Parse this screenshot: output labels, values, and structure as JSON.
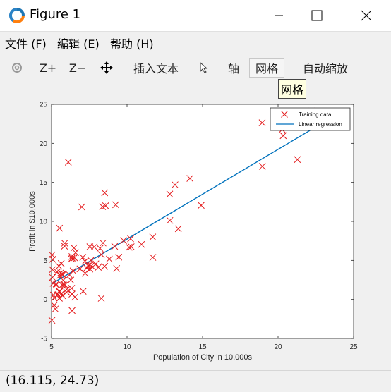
{
  "window": {
    "title": "Figure 1",
    "controls": {
      "minimize_icon": "minimize-icon",
      "maximize_icon": "maximize-icon",
      "close_icon": "close-icon"
    }
  },
  "menu": [
    {
      "label": "文件 (F)"
    },
    {
      "label": "编辑 (E)"
    },
    {
      "label": "帮助 (H)"
    }
  ],
  "toolbar": {
    "rotate_icon": "rotate-icon",
    "zoom_in": "Z+",
    "zoom_out": "Z−",
    "pan_icon": "pan-icon",
    "insert_text": "插入文本",
    "pointer_icon": "pointer-icon",
    "axes": "轴",
    "grid": "网格",
    "autoscale": "自动缩放"
  },
  "tooltip": {
    "text": "网格"
  },
  "status": {
    "coordinates": "(16.115, 24.73)"
  },
  "colors": {
    "marker": "#e41a1c",
    "line": "#0072bd"
  },
  "chart_data": {
    "type": "scatter",
    "xlabel": "Population of City in 10,000s",
    "ylabel": "Profit in $10,000s",
    "xlim": [
      5,
      25
    ],
    "ylim": [
      -5,
      25
    ],
    "xticks": [
      "5",
      "10",
      "15",
      "20",
      "25"
    ],
    "yticks": [
      "-5",
      "0",
      "5",
      "10",
      "15",
      "20",
      "25"
    ],
    "legend_position": "top-right",
    "series": [
      {
        "name": "Training data",
        "marker": "x",
        "points": [
          [
            6.1101,
            17.592
          ],
          [
            5.5277,
            9.1302
          ],
          [
            8.5186,
            13.662
          ],
          [
            7.0032,
            11.854
          ],
          [
            5.8598,
            6.8233
          ],
          [
            8.3829,
            11.886
          ],
          [
            7.4764,
            4.3483
          ],
          [
            8.5781,
            12.0
          ],
          [
            6.4862,
            6.5987
          ],
          [
            5.0546,
            3.8166
          ],
          [
            5.7107,
            3.2522
          ],
          [
            14.164,
            15.505
          ],
          [
            5.734,
            3.1551
          ],
          [
            8.4084,
            7.2258
          ],
          [
            5.6407,
            0.71618
          ],
          [
            5.3794,
            3.5129
          ],
          [
            6.3654,
            5.3048
          ],
          [
            5.1301,
            0.56077
          ],
          [
            6.4296,
            3.6518
          ],
          [
            7.0708,
            5.3893
          ],
          [
            6.1891,
            3.1386
          ],
          [
            20.27,
            21.767
          ],
          [
            5.4901,
            4.263
          ],
          [
            6.3261,
            5.1875
          ],
          [
            5.5649,
            3.0825
          ],
          [
            18.945,
            22.638
          ],
          [
            12.828,
            13.501
          ],
          [
            10.957,
            7.0467
          ],
          [
            13.176,
            14.692
          ],
          [
            22.203,
            24.147
          ],
          [
            5.2524,
            -1.22
          ],
          [
            6.5894,
            5.9966
          ],
          [
            9.2482,
            12.134
          ],
          [
            5.8918,
            1.8495
          ],
          [
            8.2111,
            6.5426
          ],
          [
            7.9334,
            4.5623
          ],
          [
            8.0959,
            4.1164
          ],
          [
            5.6063,
            3.3928
          ],
          [
            12.836,
            10.117
          ],
          [
            6.3534,
            5.4974
          ],
          [
            5.4069,
            0.55657
          ],
          [
            6.8825,
            3.9115
          ],
          [
            11.708,
            5.3854
          ],
          [
            5.7737,
            2.4406
          ],
          [
            7.8247,
            6.7318
          ],
          [
            7.0931,
            1.0463
          ],
          [
            5.0702,
            5.1337
          ],
          [
            5.8014,
            1.844
          ],
          [
            11.7,
            8.0043
          ],
          [
            5.5416,
            1.0179
          ],
          [
            7.5402,
            6.7504
          ],
          [
            5.3077,
            1.8396
          ],
          [
            7.4239,
            4.2885
          ],
          [
            7.6031,
            4.9981
          ],
          [
            6.3328,
            1.4233
          ],
          [
            6.3589,
            -1.4211
          ],
          [
            6.2742,
            2.4756
          ],
          [
            5.6397,
            4.6042
          ],
          [
            9.3102,
            3.9624
          ],
          [
            9.4536,
            5.4141
          ],
          [
            8.8254,
            5.1694
          ],
          [
            5.1793,
            -0.74279
          ],
          [
            21.279,
            17.929
          ],
          [
            14.908,
            12.054
          ],
          [
            18.959,
            17.054
          ],
          [
            7.2182,
            4.8852
          ],
          [
            8.2951,
            5.7442
          ],
          [
            10.236,
            7.7754
          ],
          [
            5.4994,
            1.0173
          ],
          [
            20.341,
            20.992
          ],
          [
            10.136,
            6.6799
          ],
          [
            7.3345,
            4.0259
          ],
          [
            6.0062,
            1.2784
          ],
          [
            7.2259,
            3.3411
          ],
          [
            5.0269,
            -2.6807
          ],
          [
            6.5479,
            0.29678
          ],
          [
            7.5386,
            3.8845
          ],
          [
            5.0365,
            5.7014
          ],
          [
            10.274,
            6.7526
          ],
          [
            5.1077,
            2.0576
          ],
          [
            5.7292,
            0.47953
          ],
          [
            5.1884,
            0.20421
          ],
          [
            6.3557,
            0.67861
          ],
          [
            9.7687,
            7.5435
          ],
          [
            6.5159,
            5.3436
          ],
          [
            8.5172,
            4.2415
          ],
          [
            9.1802,
            6.7981
          ],
          [
            6.002,
            0.92695
          ],
          [
            5.5204,
            0.152
          ],
          [
            5.0594,
            2.8214
          ],
          [
            5.7077,
            1.8451
          ],
          [
            7.6366,
            4.2959
          ],
          [
            5.8707,
            7.2029
          ],
          [
            5.3054,
            1.9869
          ],
          [
            8.2934,
            0.14454
          ],
          [
            13.394,
            9.0551
          ],
          [
            5.4369,
            0.61705
          ]
        ]
      },
      {
        "name": "Linear regression",
        "line_from": [
          5.0269,
          2.0149
        ],
        "line_to": [
          22.203,
          21.763
        ]
      }
    ]
  }
}
